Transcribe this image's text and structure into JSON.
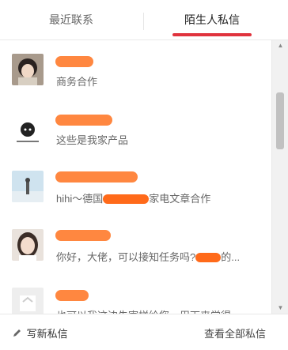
{
  "tabs": {
    "recent": "最近联系",
    "strangers": "陌生人私信"
  },
  "messages": [
    {
      "preview": "商务合作"
    },
    {
      "preview": "这些是我家产品"
    },
    {
      "preview_a": "hihi～德国",
      "preview_b": "家电文章合作"
    },
    {
      "preview_a": "你好，大佬，可以接知任务吗?",
      "preview_b": "的..."
    },
    {
      "preview": "也可以我这边先寄样给您，用下来觉得"
    }
  ],
  "footer": {
    "compose": "写新私信",
    "view_all": "查看全部私信"
  },
  "colors": {
    "accent": "#e0333d",
    "redaction": "#ff6a1a"
  }
}
